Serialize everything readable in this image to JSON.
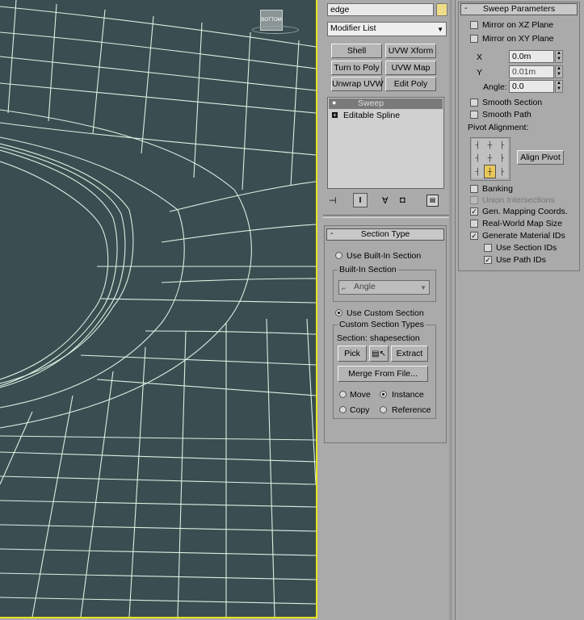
{
  "viewport": {
    "view_cube_label": "BOTTOM"
  },
  "modify_panel": {
    "object_name": "edge",
    "object_color": "#eedd88",
    "modifier_list_label": "Modifier List",
    "modifier_buttons": [
      "Shell",
      "UVW Xform",
      "Turn to Poly",
      "UVW Map",
      "Unwrap UVW",
      "Edit Poly"
    ],
    "stack": [
      {
        "label": "Sweep",
        "selected": true
      },
      {
        "label": "Editable Spline",
        "selected": false
      }
    ]
  },
  "section_type": {
    "title": "Section Type",
    "use_builtin_label": "Use Built-In Section",
    "builtin_group_label": "Built-In Section",
    "builtin_value": "Angle",
    "use_custom_label": "Use Custom Section",
    "custom_group_label": "Custom Section Types",
    "section_label": "Section: shapesection",
    "pick_label": "Pick",
    "extract_label": "Extract",
    "merge_label": "Merge From File...",
    "move_label": "Move",
    "instance_label": "Instance",
    "copy_label": "Copy",
    "reference_label": "Reference"
  },
  "sweep_params": {
    "title": "Sweep Parameters",
    "mirror_xz": "Mirror on XZ Plane",
    "mirror_xy": "Mirror on XY Plane",
    "x_label": "X",
    "x_value": "0.0m",
    "y_label": "Y",
    "y_value": "0.01m",
    "angle_label": "Angle:",
    "angle_value": "0.0",
    "smooth_section": "Smooth Section",
    "smooth_path": "Smooth Path",
    "pivot_alignment": "Pivot Alignment:",
    "align_pivot": "Align Pivot",
    "banking": "Banking",
    "union_intersections": "Union Intersections",
    "gen_mapping": "Gen. Mapping Coords.",
    "real_world": "Real-World Map Size",
    "gen_material_ids": "Generate Material IDs",
    "use_section_ids": "Use Section IDs",
    "use_path_ids": "Use Path IDs"
  },
  "colors": {
    "viewport_bg": "#3a4d50",
    "wire": "#d6f2e2",
    "active_border": "#e8e21e",
    "panel_bg": "#aaaaaa"
  }
}
